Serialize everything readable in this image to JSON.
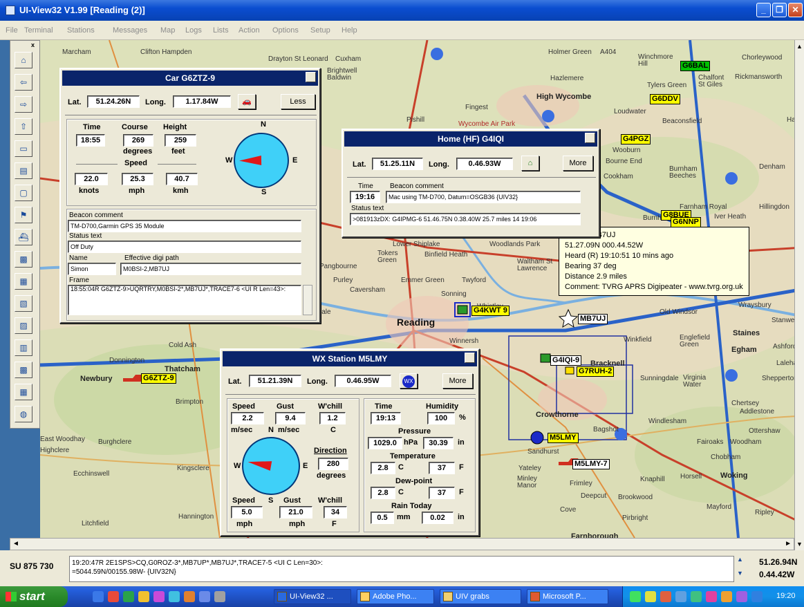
{
  "window": {
    "title": "UI-View32 V1.99 [Reading (2)]"
  },
  "menu": [
    "File",
    "Terminal",
    "Stations",
    "Messages",
    "Map",
    "Logs",
    "Lists",
    "Action",
    "Options",
    "Setup",
    "Help"
  ],
  "toolbar": {
    "close": "x",
    "buttons": [
      {
        "name": "map-icon",
        "glyph": "⌂"
      },
      {
        "name": "arrow-left-icon",
        "glyph": "⇦"
      },
      {
        "name": "arrow-right-icon",
        "glyph": "⇨"
      },
      {
        "name": "arrow-up-icon",
        "glyph": "⇧"
      },
      {
        "name": "window-icon",
        "glyph": "▭"
      },
      {
        "name": "printer-icon",
        "glyph": "▤"
      },
      {
        "name": "frame-icon",
        "glyph": "▢"
      },
      {
        "name": "flag-icon",
        "glyph": "⚑"
      },
      {
        "name": "ship-icon",
        "glyph": "⛴"
      },
      {
        "name": "map-tile-1-icon",
        "glyph": "▩"
      },
      {
        "name": "map-tile-2-icon",
        "glyph": "▦"
      },
      {
        "name": "map-tile-3-icon",
        "glyph": "▧"
      },
      {
        "name": "map-tile-4-icon",
        "glyph": "▨"
      },
      {
        "name": "map-tile-5-icon",
        "glyph": "▥"
      },
      {
        "name": "map-tile-6-icon",
        "glyph": "▩"
      },
      {
        "name": "map-tile-7-icon",
        "glyph": "▦"
      },
      {
        "name": "globe-icon",
        "glyph": "◍"
      }
    ]
  },
  "map": {
    "places": [
      {
        "t": "Marcham"
      },
      {
        "t": "Clifton Hampden"
      },
      {
        "t": "Drayton St Leonard"
      },
      {
        "t": "Cuxham"
      },
      {
        "t": "Brightwell Baldwin"
      },
      {
        "t": "Holmer Green"
      },
      {
        "t": "A404"
      },
      {
        "t": "Winchmore Hill"
      },
      {
        "t": "Chorleywood"
      },
      {
        "t": "Hazlemere"
      },
      {
        "t": "Rickmansworth"
      },
      {
        "t": "Chalfont St Giles"
      },
      {
        "t": "Tylers Green"
      },
      {
        "t": "High Wycombe"
      },
      {
        "t": "Loudwater"
      },
      {
        "t": "Fingest"
      },
      {
        "t": "Pishill"
      },
      {
        "t": "Wycombe Air Park"
      },
      {
        "t": "Beaconsfield"
      },
      {
        "t": "Wooburn"
      },
      {
        "t": "Bourne End"
      },
      {
        "t": "Cookham"
      },
      {
        "t": "Burnham Beeches"
      },
      {
        "t": "Denham"
      },
      {
        "t": "Farnham Royal"
      },
      {
        "t": "Burnham"
      },
      {
        "t": "Iver Heath"
      },
      {
        "t": "Hillingdon"
      },
      {
        "t": "Lower Shiplake"
      },
      {
        "t": "Woodlands Park"
      },
      {
        "t": "Tokers Green"
      },
      {
        "t": "Binfield Heath"
      },
      {
        "t": "Waltham St Lawrence"
      },
      {
        "t": "Pangbourne"
      },
      {
        "t": "Purley"
      },
      {
        "t": "Emmer Green"
      },
      {
        "t": "Twyford"
      },
      {
        "t": "Caversham"
      },
      {
        "t": "Sonning"
      },
      {
        "t": "Whistley"
      },
      {
        "t": "Reading"
      },
      {
        "t": "Theale"
      },
      {
        "t": "Winnersh"
      },
      {
        "t": "Old Windsor"
      },
      {
        "t": "Wraysbury"
      },
      {
        "t": "Staines"
      },
      {
        "t": "Stanwell"
      },
      {
        "t": "Englefield Green"
      },
      {
        "t": "Egham"
      },
      {
        "t": "Ashford"
      },
      {
        "t": "Laleham"
      },
      {
        "t": "Shepperton"
      },
      {
        "t": "Winkfield"
      },
      {
        "t": "Bracknell"
      },
      {
        "t": "Sunningdale"
      },
      {
        "t": "Virginia Water"
      },
      {
        "t": "Chertsey"
      },
      {
        "t": "Addlestone"
      },
      {
        "t": "Ottershaw"
      },
      {
        "t": "Cold Ash"
      },
      {
        "t": "Thatcham"
      },
      {
        "t": "Donnington"
      },
      {
        "t": "Newbury"
      },
      {
        "t": "Brimpton"
      },
      {
        "t": "Crowthorne"
      },
      {
        "t": "Windlesham"
      },
      {
        "t": "Bagshot"
      },
      {
        "t": "Sandhurst"
      },
      {
        "t": "Fairoaks"
      },
      {
        "t": "Woodham"
      },
      {
        "t": "Chobham"
      },
      {
        "t": "East Woodhay"
      },
      {
        "t": "Burghclere"
      },
      {
        "t": "Highclere"
      },
      {
        "t": "Ecchinswell"
      },
      {
        "t": "Kingsclere"
      },
      {
        "t": "Yateley"
      },
      {
        "t": "Minley Manor"
      },
      {
        "t": "Frimley"
      },
      {
        "t": "Knaphill"
      },
      {
        "t": "Horsell"
      },
      {
        "t": "Woking"
      },
      {
        "t": "Deepcut"
      },
      {
        "t": "Brookwood"
      },
      {
        "t": "Pirbright"
      },
      {
        "t": "Mayford"
      },
      {
        "t": "Ripley"
      },
      {
        "t": "Cove"
      },
      {
        "t": "Farnborough"
      },
      {
        "t": "Litchfield"
      },
      {
        "t": "Hannington"
      },
      {
        "t": "Harefield"
      }
    ],
    "stations": [
      {
        "call": "G6ZTZ-9"
      },
      {
        "call": "G4KWT 9"
      },
      {
        "call": "G4IQI-9"
      },
      {
        "call": "G7RUH-2"
      },
      {
        "call": "MB7UJ"
      },
      {
        "call": "M5LMY"
      },
      {
        "call": "M5LMY-7"
      },
      {
        "call": "G8BUE"
      },
      {
        "call": "G6NNP"
      },
      {
        "call": "G4PGZ"
      },
      {
        "call": "G6DDV"
      },
      {
        "call": "G6BAL"
      }
    ],
    "tooltip": [
      "Station MB7UJ",
      "51.27.09N 000.44.52W",
      "Heard (R) 19:10:51  10 mins ago",
      "Bearing 37 deg",
      "Distance 2.9 miles",
      "Comment:  TVRG APRS Digipeater - www.tvrg.org.uk"
    ]
  },
  "car": {
    "title": "Car  G6ZTZ-9",
    "lat_label": "Lat.",
    "lat": "51.24.26N",
    "long_label": "Long.",
    "long": "1.17.84W",
    "less": "Less",
    "time_label": "Time",
    "time": "18:55",
    "course_label": "Course",
    "course": "269",
    "course_unit": "degrees",
    "height_label": "Height",
    "height": "259",
    "height_unit": "feet",
    "speed_label": "Speed",
    "knots": "22.0",
    "knots_unit": "knots",
    "mph": "25.3",
    "mph_unit": "mph",
    "kmh": "40.7",
    "kmh_unit": "kmh",
    "compass": {
      "n": "N",
      "e": "E",
      "s": "S",
      "w": "W",
      "heading_deg": 269
    },
    "beacon_label": "Beacon comment",
    "beacon": "TM-D700,Garmin GPS 35 Module",
    "status_label": "Status text",
    "status": "Off Duty",
    "name_label": "Name",
    "name": "Simon",
    "digi_label": "Effective digi path",
    "digi": "M0BSI-2,MB7UJ",
    "frame_label": "Frame",
    "frame": "18:55:04R G6ZTZ-9>UQRTRY,M0BSI-2*,MB7UJ*,TRACE7-6 <UI R Len=43>:"
  },
  "home": {
    "title": "Home (HF)  G4IQI",
    "lat_label": "Lat.",
    "lat": "51.25.11N",
    "long_label": "Long.",
    "long": "0.46.93W",
    "more": "More",
    "time_label": "Time",
    "time": "19:16",
    "beacon_label": "Beacon comment",
    "beacon": "Mac using TM-D700, Datum=OSGB36 {UIV32}",
    "status_label": "Status text",
    "status": ">081913zDX: G4IPMG-6 51.46.75N 0.38.40W 25.7 miles 14  19:06"
  },
  "wx": {
    "title": "WX Station  M5LMY",
    "lat_label": "Lat.",
    "lat": "51.21.39N",
    "long_label": "Long.",
    "long": "0.46.95W",
    "more": "More",
    "speed_label": "Speed",
    "speed": "2.2",
    "speed_unit": "m/sec",
    "gust_label": "Gust",
    "gust": "9.4",
    "gust_unit": "m/sec",
    "wchill_label": "W'chill",
    "wchill": "1.2",
    "wchill_unit": "C",
    "direction_label": "Direction",
    "direction": "280",
    "direction_unit": "degrees",
    "speed2_label": "Speed",
    "speed2": "5.0",
    "speed2_unit": "mph",
    "gust2_label": "Gust",
    "gust2": "21.0",
    "gust2_unit": "mph",
    "wchill2_label": "W'chill",
    "wchill2": "34",
    "wchill2_unit": "F",
    "compass": {
      "n": "N",
      "e": "E",
      "s": "S",
      "w": "W",
      "heading_deg": 280
    },
    "time_label": "Time",
    "time": "19:13",
    "humidity_label": "Humidity",
    "humidity": "100",
    "humidity_unit": "%",
    "pressure_label": "Pressure",
    "pressure_hpa": "1029.0",
    "hpa_unit": "hPa",
    "pressure_in": "30.39",
    "in_unit": "in",
    "temp_label": "Temperature",
    "temp_c": "2.8",
    "c_unit": "C",
    "temp_f": "37",
    "f_unit": "F",
    "dew_label": "Dew-point",
    "dew_c": "2.8",
    "dew_f": "37",
    "rain_label": "Rain Today",
    "rain_mm": "0.5",
    "mm_unit": "mm",
    "rain_in": "0.02",
    "rain_in_unit": "in"
  },
  "status": {
    "gridref": "SU 875 730",
    "line1": "19:20:47R 2E1SPS>CQ,G0ROZ-3*,MB7UP*,MB7UJ*,TRACE7-5 <UI C Len=30>:",
    "line2": "=5044.59N/00155.98W- {UIV32N}",
    "lat": "51.26.94N",
    "long": "0.44.42W"
  },
  "taskbar": {
    "start": "start",
    "tasks": [
      "UI-View32 ...",
      "Adobe Pho...",
      "UIV grabs",
      "Microsoft P..."
    ],
    "clock": "19:20"
  }
}
